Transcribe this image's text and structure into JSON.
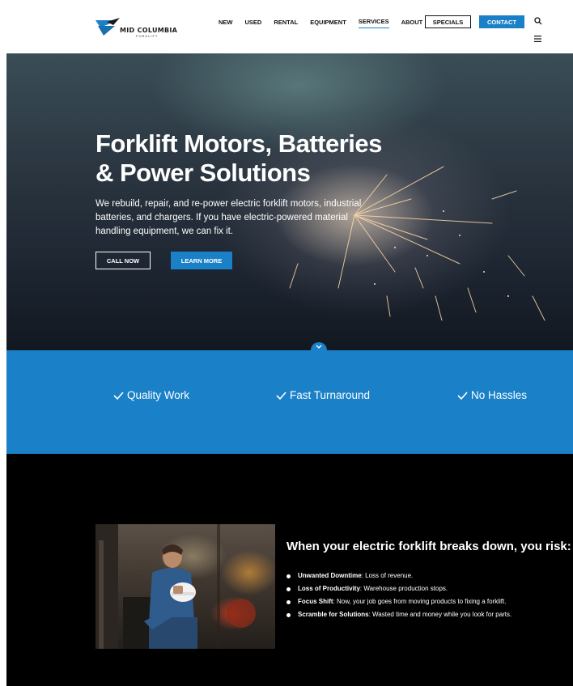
{
  "header": {
    "logo_name": "MID COLUMBIA",
    "logo_sub": "FORKLIFT",
    "nav": [
      {
        "label": "NEW",
        "active": false
      },
      {
        "label": "USED",
        "active": false
      },
      {
        "label": "RENTAL",
        "active": false
      },
      {
        "label": "EQUIPMENT",
        "active": false
      },
      {
        "label": "SERVICES",
        "active": true
      },
      {
        "label": "ABOUT",
        "active": false
      }
    ],
    "specials_label": "SPECIALS",
    "contact_label": "CONTACT",
    "search_icon": "search-icon",
    "menu_icon": "hamburger-menu-icon"
  },
  "hero": {
    "title_line1": "Forklift Motors, Batteries",
    "title_line2": "& Power Solutions",
    "text": "We rebuild, repair, and re-power electric forklift motors, industrial batteries, and chargers. If you have electric-powered material handling equipment, we can fix it.",
    "call_label": "CALL NOW",
    "learn_label": "LEARN MORE",
    "scroll_icon": "chevron-down-icon"
  },
  "features": [
    {
      "label": "Quality Work"
    },
    {
      "label": "Fast Turnaround"
    },
    {
      "label": "No Hassles"
    }
  ],
  "risks": {
    "title": "When your electric forklift breaks down, you risk:",
    "items": [
      {
        "term": "Unwanted Downtime",
        "desc": ": Loss of revenue."
      },
      {
        "term": "Loss of Productivity",
        "desc": ": Warehouse production stops."
      },
      {
        "term": "Focus Shift",
        "desc": ": Now, your job goes from moving products to fixing a forklift."
      },
      {
        "term": "Scramble for Solutions",
        "desc": ": Wasted time and money while you look for parts."
      }
    ]
  },
  "colors": {
    "brand_blue": "#1a80c8",
    "dark_bg": "#000000",
    "header_bg": "#ffffff"
  }
}
